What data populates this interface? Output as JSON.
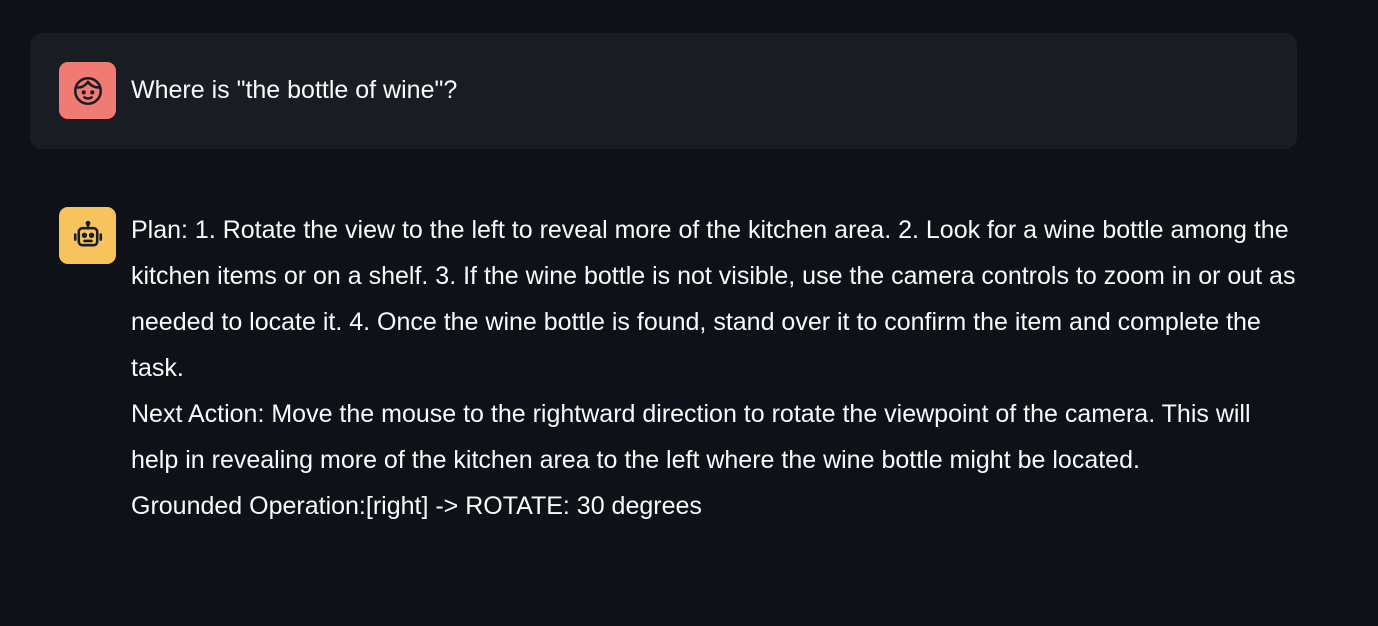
{
  "messages": {
    "user": {
      "avatar_icon": "face-icon",
      "avatar_color": "#f07b74",
      "text": "Where is \"the bottle of wine\"?"
    },
    "assistant": {
      "avatar_icon": "robot-icon",
      "avatar_color": "#f6c35d",
      "plan": "Plan: 1. Rotate the view to the left to reveal more of the kitchen area. 2. Look for a wine bottle among the kitchen items or on a shelf. 3. If the wine bottle is not visible, use the camera controls to zoom in or out as needed to locate it. 4. Once the wine bottle is found, stand over it to confirm the item and complete the task.",
      "next_action": "Next Action: Move the mouse to the rightward direction to rotate the viewpoint of the camera. This will help in revealing more of the kitchen area to the left where the wine bottle might be located.",
      "grounded_operation": "Grounded Operation:[right] -> ROTATE: 30 degrees"
    }
  },
  "colors": {
    "background": "#0e1117",
    "user_bubble": "#1a1c24",
    "text": "#fafafa"
  }
}
